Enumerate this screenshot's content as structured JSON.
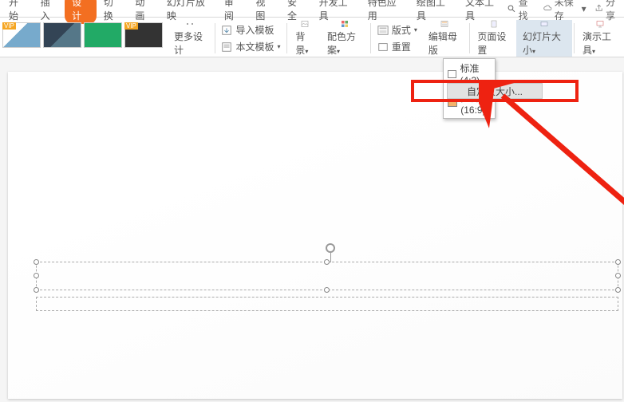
{
  "tabs": [
    "开始",
    "插入",
    "设计",
    "切换",
    "动画",
    "幻灯片放映",
    "审阅",
    "视图",
    "安全",
    "开发工具",
    "特色应用",
    "绘图工具",
    "文本工具"
  ],
  "activeTabIndex": 2,
  "topRight": {
    "search": "查找",
    "unsaved": "未保存",
    "share": "分享"
  },
  "ribbon": {
    "more": "更多设计",
    "importTemplate": "导入模板",
    "bodyTemplate": "本文模板",
    "background": "背景",
    "colorScheme": "配色方案",
    "layout": "版式",
    "reset": "重置",
    "editMaster": "编辑母版",
    "pageSetup": "页面设置",
    "slideSize": "幻灯片大小",
    "presentTools": "演示工具"
  },
  "dropdown": {
    "standard": "标准(4:3)",
    "wide": "宽屏(16:9)",
    "custom": "自定义大小..."
  }
}
